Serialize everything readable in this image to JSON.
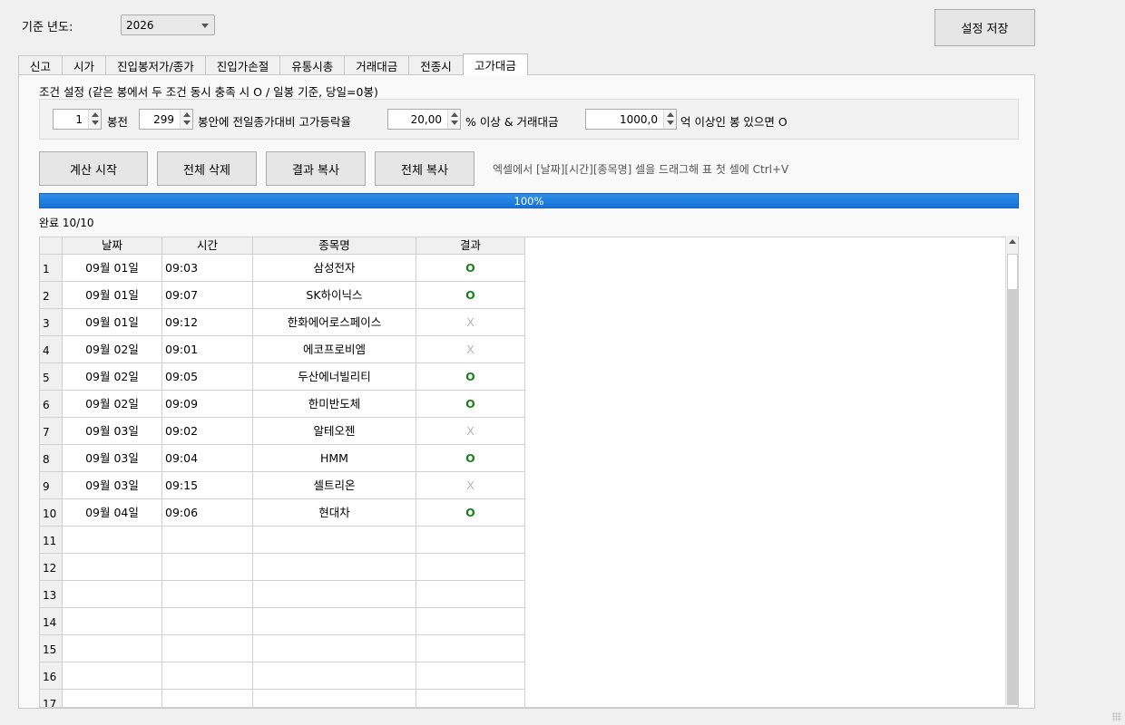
{
  "header": {
    "year_label": "기준 년도:",
    "year_value": "2026",
    "save_button": "설정 저장"
  },
  "tabs": [
    "신고",
    "시가",
    "진입봉저가/종가",
    "진입가손절",
    "유통시총",
    "거래대금",
    "전종시",
    "고가대금"
  ],
  "active_tab": "고가대금",
  "conditions": {
    "title": "조건 설정 (같은 봉에서 두 조건 동시 충족 시 O / 일봉 기준, 당일=0봉)",
    "bars_before_value": "1",
    "bars_before_label": "봉전",
    "period_value": "299",
    "period_label": "봉안에 전일종가대비 고가등락율",
    "pct_value": "20,00",
    "pct_label": "% 이상 & 거래대금",
    "amount_value": "1000,0",
    "amount_label": "억 이상인 봉 있으면 O"
  },
  "buttons": {
    "calc_start": "계산 시작",
    "delete_all": "전체 삭제",
    "copy_result": "결과 복사",
    "copy_all": "전체 복사"
  },
  "hint": "엑셀에서 [날짜][시간][종목명] 셀을 드래그해 표 첫 셀에 Ctrl+V",
  "progress": {
    "percent": 100,
    "text": "100%"
  },
  "status": "완료 10/10",
  "table": {
    "columns": [
      "날짜",
      "시간",
      "종목명",
      "결과"
    ],
    "rows": [
      {
        "n": "1",
        "date": "09월 01일",
        "time": "09:03",
        "name": "삼성전자",
        "result": "O"
      },
      {
        "n": "2",
        "date": "09월 01일",
        "time": "09:07",
        "name": "SK하이닉스",
        "result": "O"
      },
      {
        "n": "3",
        "date": "09월 01일",
        "time": "09:12",
        "name": "한화에어로스페이스",
        "result": "X"
      },
      {
        "n": "4",
        "date": "09월 02일",
        "time": "09:01",
        "name": "에코프로비엠",
        "result": "X"
      },
      {
        "n": "5",
        "date": "09월 02일",
        "time": "09:05",
        "name": "두산에너빌리티",
        "result": "O"
      },
      {
        "n": "6",
        "date": "09월 02일",
        "time": "09:09",
        "name": "한미반도체",
        "result": "O"
      },
      {
        "n": "7",
        "date": "09월 03일",
        "time": "09:02",
        "name": "알테오젠",
        "result": "X"
      },
      {
        "n": "8",
        "date": "09월 03일",
        "time": "09:04",
        "name": "HMM",
        "result": "O"
      },
      {
        "n": "9",
        "date": "09월 03일",
        "time": "09:15",
        "name": "셀트리온",
        "result": "X"
      },
      {
        "n": "10",
        "date": "09월 04일",
        "time": "09:06",
        "name": "현대차",
        "result": "O"
      },
      {
        "n": "11",
        "date": "",
        "time": "",
        "name": "",
        "result": ""
      },
      {
        "n": "12",
        "date": "",
        "time": "",
        "name": "",
        "result": ""
      },
      {
        "n": "13",
        "date": "",
        "time": "",
        "name": "",
        "result": ""
      },
      {
        "n": "14",
        "date": "",
        "time": "",
        "name": "",
        "result": ""
      },
      {
        "n": "15",
        "date": "",
        "time": "",
        "name": "",
        "result": ""
      },
      {
        "n": "16",
        "date": "",
        "time": "",
        "name": "",
        "result": ""
      },
      {
        "n": "17",
        "date": "",
        "time": "",
        "name": "",
        "result": ""
      }
    ]
  },
  "colors": {
    "result_o": "#1e7e1e",
    "result_x": "#b4b4b4",
    "progress": "#1472d6"
  }
}
